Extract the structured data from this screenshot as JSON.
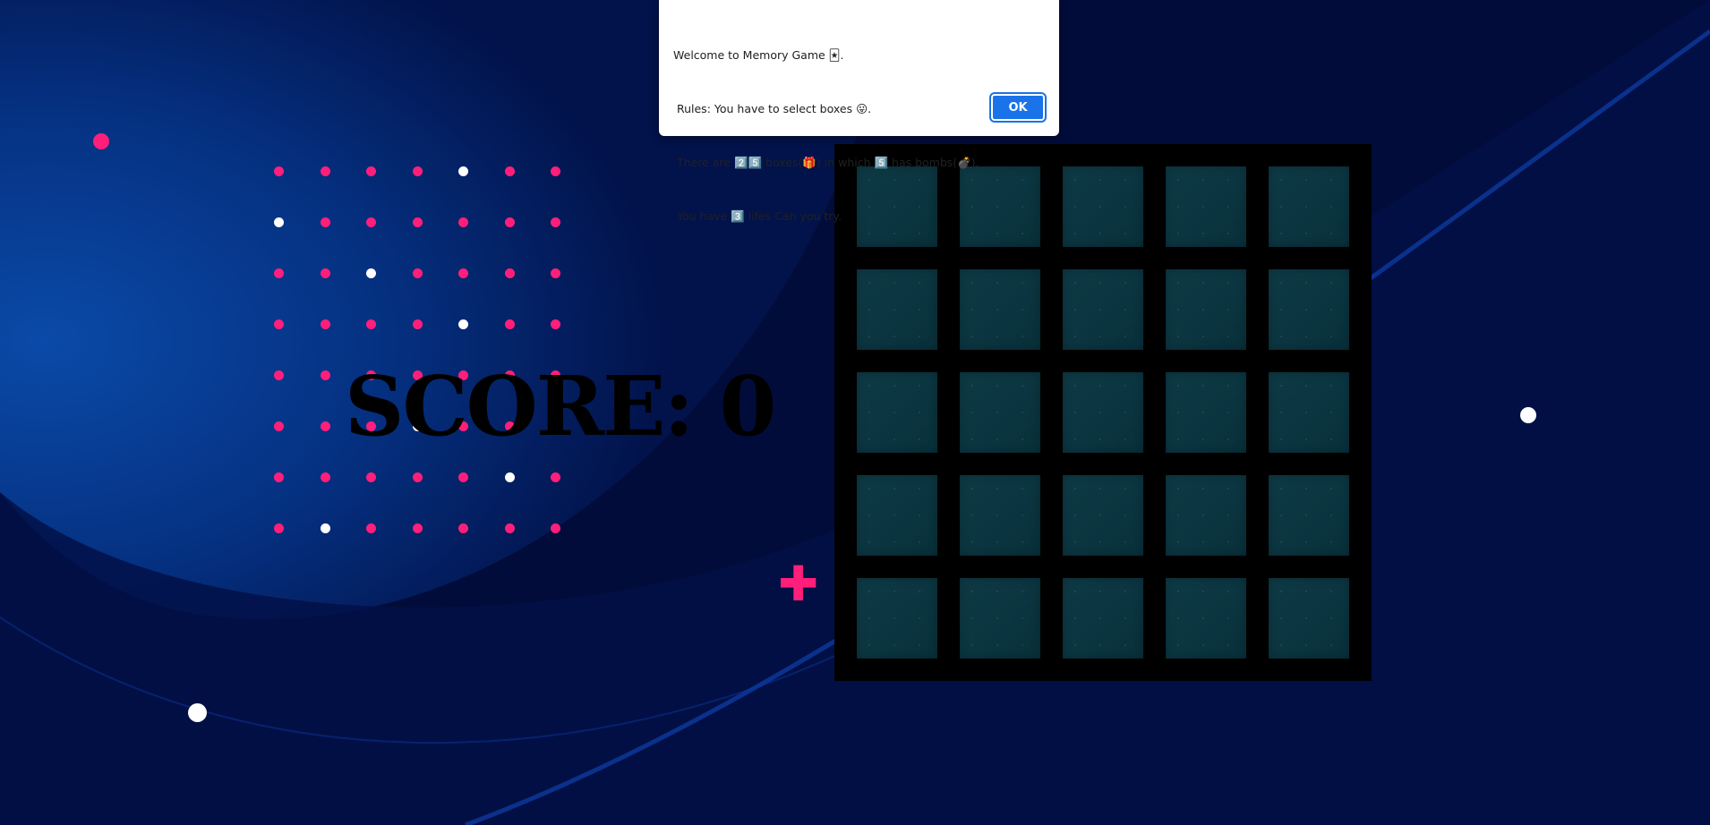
{
  "game": {
    "score_label": "SCORE: 0",
    "rows": 5,
    "cols": 5
  },
  "dialog": {
    "lines": [
      "Welcome to Memory Game 🃏.",
      " Rules: You have to select boxes 😛.",
      " There are 2️⃣5️⃣ boxes(🎁) in which 5️⃣ has bombs(💣).",
      " You have 3️⃣ lifes Can you try."
    ],
    "ok_label": "OK"
  },
  "colors": {
    "background": "#020c3a",
    "accent_pink": "#ff1f7a",
    "tile": "#0b3540",
    "board": "#000000",
    "dialog_button": "#1a73e8"
  },
  "decor": {
    "white_dots": [
      [
        1,
        5
      ],
      [
        2,
        1
      ],
      [
        3,
        3
      ],
      [
        4,
        5
      ],
      [
        6,
        4
      ],
      [
        7,
        6
      ],
      [
        8,
        2
      ]
    ]
  }
}
